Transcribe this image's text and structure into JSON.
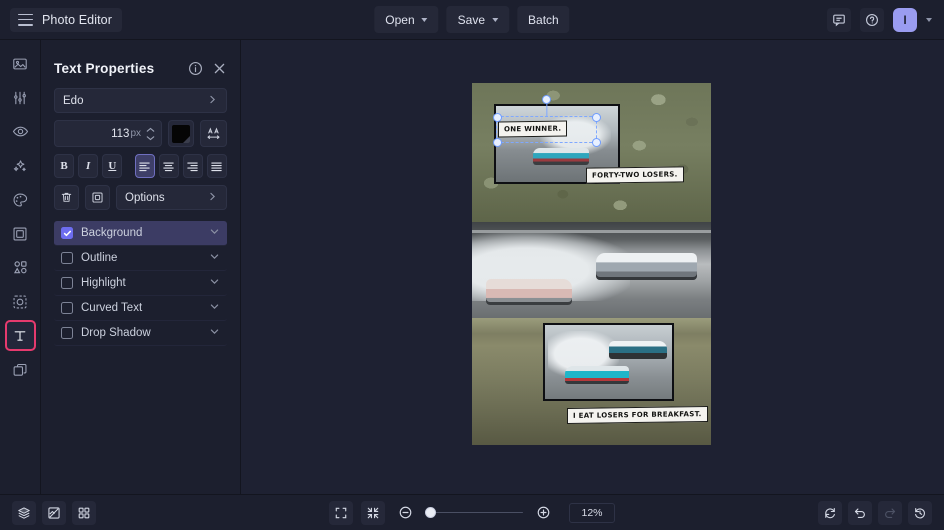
{
  "app": {
    "title": "Photo Editor",
    "menu_icon": "hamburger-icon"
  },
  "topbar": {
    "open_label": "Open",
    "save_label": "Save",
    "batch_label": "Batch",
    "comment_icon": "comment-icon",
    "help_icon": "help-icon",
    "avatar_initial": "I"
  },
  "sidebar": {
    "items": [
      {
        "name": "image",
        "icon": "image-icon",
        "active": false
      },
      {
        "name": "adjust",
        "icon": "sliders-icon",
        "active": false
      },
      {
        "name": "retouch",
        "icon": "eye-icon",
        "active": false
      },
      {
        "name": "effects",
        "icon": "sparkles-icon",
        "active": false
      },
      {
        "name": "paint",
        "icon": "palette-icon",
        "active": false
      },
      {
        "name": "frames",
        "icon": "frame-icon",
        "active": false
      },
      {
        "name": "shapes",
        "icon": "shapes-icon",
        "active": false
      },
      {
        "name": "cutout",
        "icon": "cutout-icon",
        "active": false
      },
      {
        "name": "text",
        "icon": "text-icon",
        "active": true
      },
      {
        "name": "overlay",
        "icon": "overlay-icon",
        "active": false
      }
    ]
  },
  "panel": {
    "title": "Text Properties",
    "info_icon": "info-icon",
    "close_icon": "close-icon",
    "font": {
      "value": "Edo",
      "chevron": "chevron-right-icon"
    },
    "size": {
      "value": "113",
      "unit": "px"
    },
    "color_swatch": "#050505",
    "letter_spacing_icon": "AA",
    "format": [
      {
        "label": "B",
        "name": "bold",
        "active": false
      },
      {
        "label": "I",
        "name": "italic",
        "active": false
      },
      {
        "label": "U",
        "name": "underline",
        "active": false
      }
    ],
    "align": [
      {
        "name": "align-left",
        "active": true
      },
      {
        "name": "align-center",
        "active": false
      },
      {
        "name": "align-right",
        "active": false
      },
      {
        "name": "align-justify",
        "active": false
      }
    ],
    "delete_icon": "trash-icon",
    "duplicate_icon": "duplicate-icon",
    "options_label": "Options",
    "effects": [
      {
        "label": "Background",
        "checked": true,
        "selected": true
      },
      {
        "label": "Outline",
        "checked": false,
        "selected": false
      },
      {
        "label": "Highlight",
        "checked": false,
        "selected": false
      },
      {
        "label": "Curved Text",
        "checked": false,
        "selected": false
      },
      {
        "label": "Drop Shadow",
        "checked": false,
        "selected": false
      }
    ]
  },
  "canvas": {
    "captions": [
      {
        "id": "cap1",
        "text": "ONE WINNER.",
        "selected": true
      },
      {
        "id": "cap2",
        "text": "FORTY-TWO LOSERS.",
        "selected": false
      },
      {
        "id": "cap3",
        "text": "I EAT LOSERS FOR BREAKFAST.",
        "selected": false
      }
    ]
  },
  "bottombar": {
    "layers_icon": "layers-icon",
    "replace_icon": "replace-image-icon",
    "grid_icon": "grid-icon",
    "fullscreen_icon": "fullscreen-icon",
    "fit_icon": "fit-to-screen-icon",
    "zoom_out_icon": "zoom-out-icon",
    "zoom_in_icon": "zoom-in-icon",
    "zoom_level": "12%",
    "reset_icon": "reset-icon",
    "undo_icon": "undo-icon",
    "redo_icon": "redo-icon",
    "history_icon": "history-icon"
  },
  "colors": {
    "accent_purple": "#6d6df0",
    "active_tool_border": "#e63a6e",
    "panel_bg": "#1c1f2e",
    "canvas_bg": "#1e2132"
  }
}
